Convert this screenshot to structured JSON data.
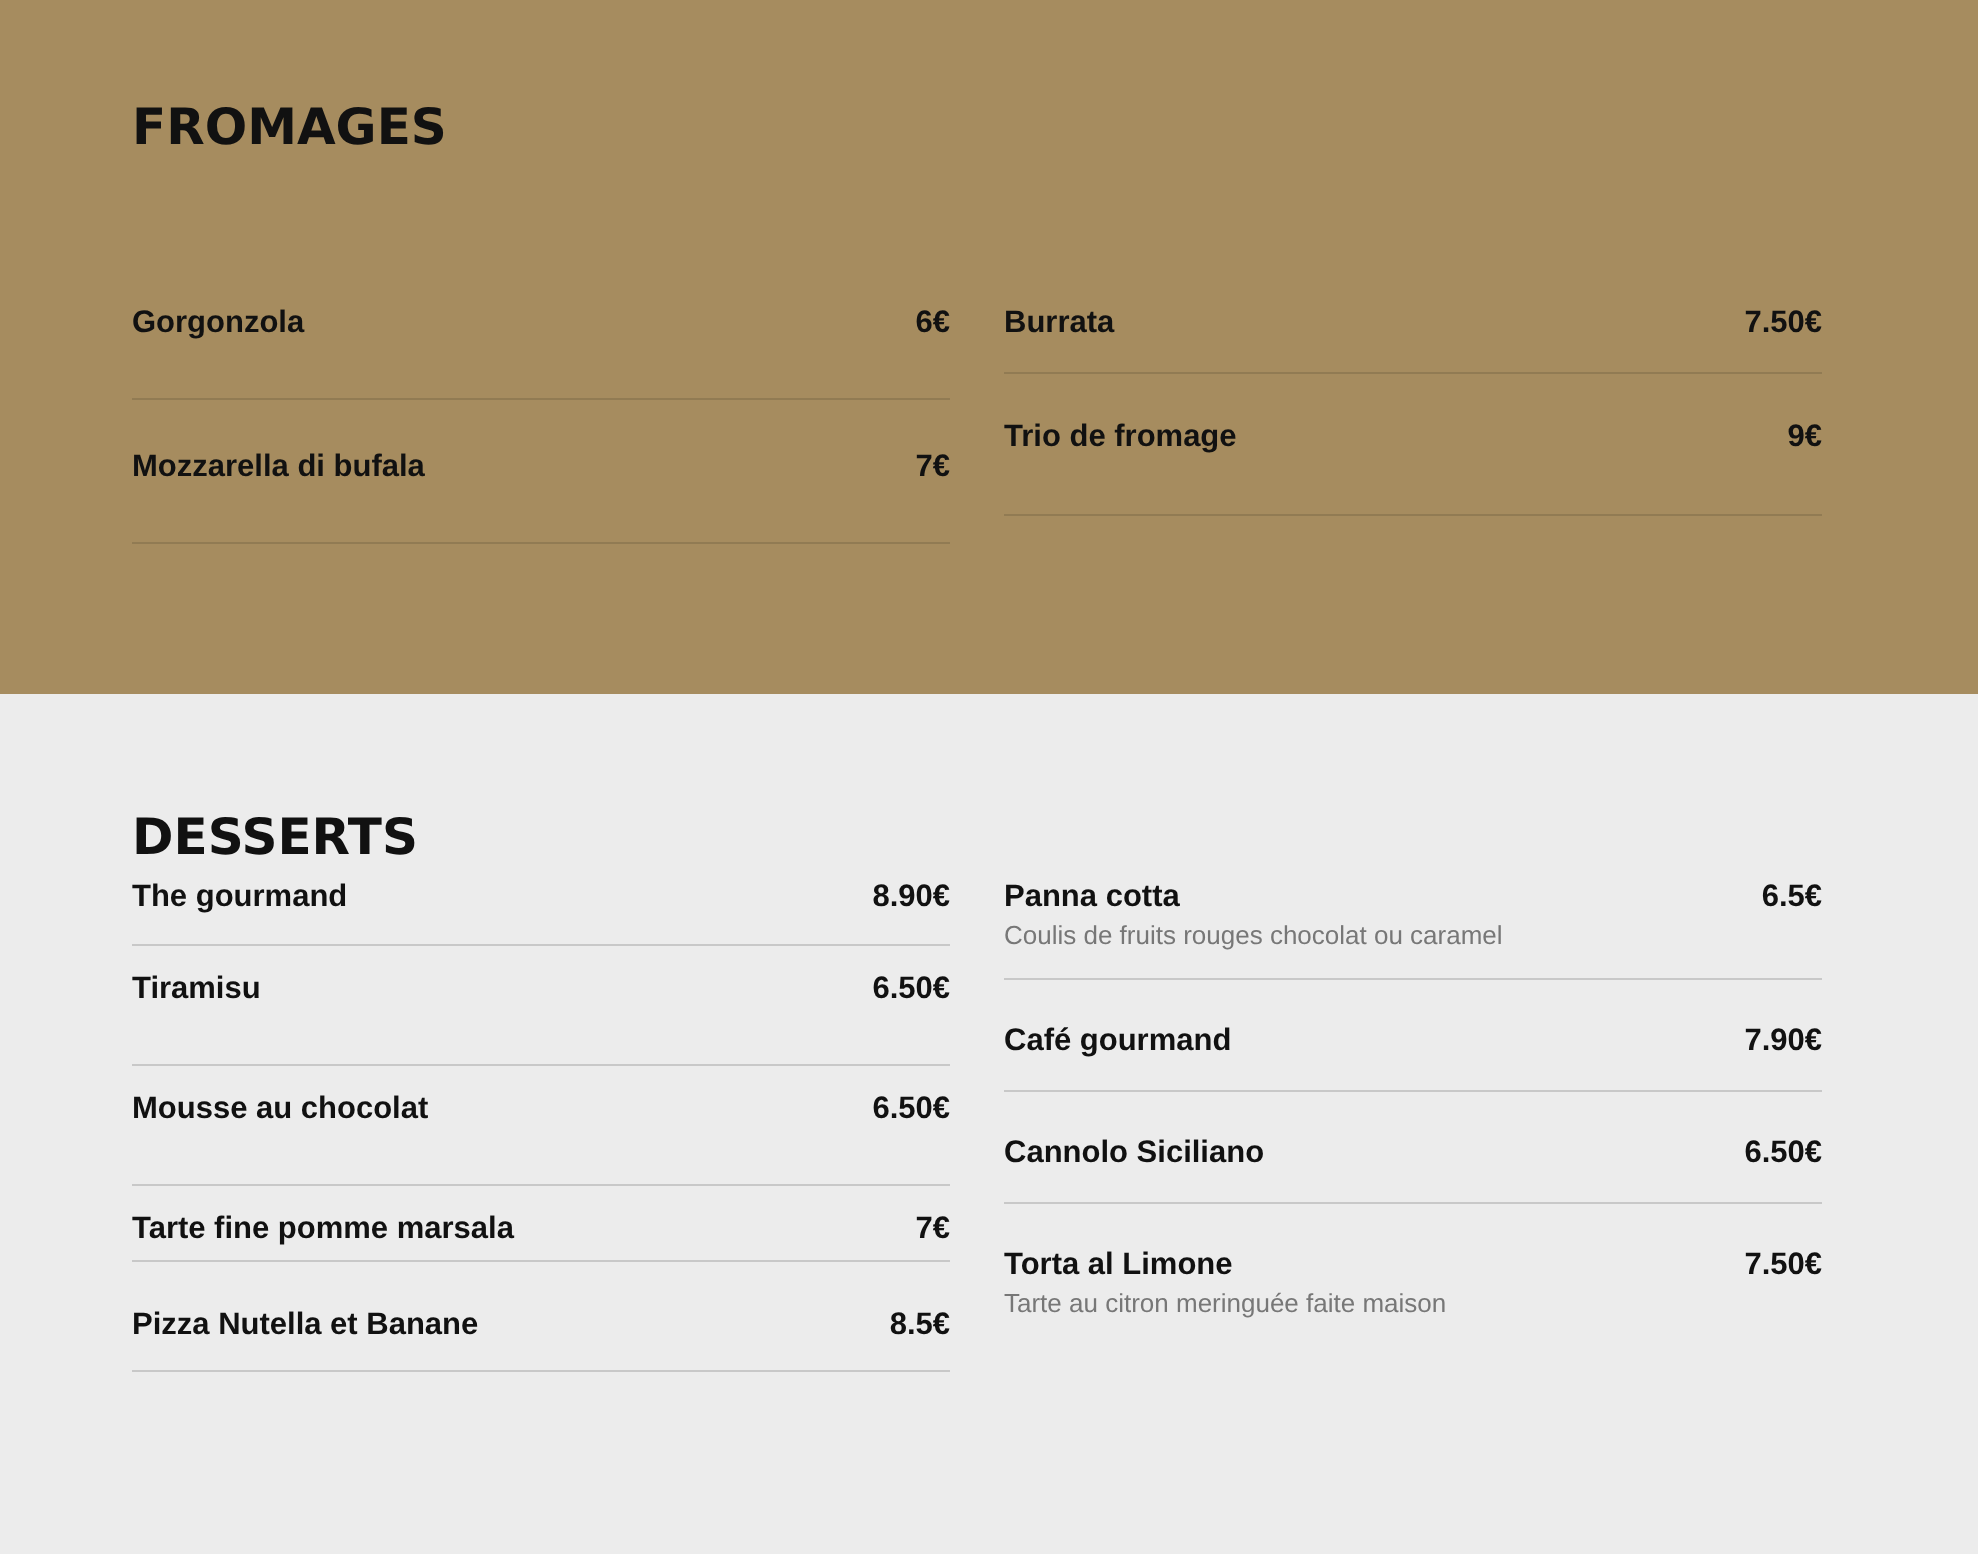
{
  "sections": [
    {
      "title": "FROMAGES",
      "kind": "dark",
      "columns": [
        [
          {
            "name": "Gorgonzola",
            "price": "6€"
          },
          {
            "name": "Mozzarella di bufala",
            "price": "7€"
          }
        ],
        [
          {
            "name": "Burrata",
            "price": "7.50€"
          },
          {
            "name": "Trio de fromage",
            "price": "9€"
          }
        ]
      ]
    },
    {
      "title": "DESSERTS",
      "kind": "light",
      "columns": [
        [
          {
            "name": "The gourmand",
            "price": "8.90€"
          },
          {
            "name": "Tiramisu",
            "price": "6.50€"
          },
          {
            "name": "Mousse au chocolat",
            "price": "6.50€"
          },
          {
            "name": "Tarte fine pomme marsala",
            "price": "7€"
          },
          {
            "name": "Pizza Nutella et Banane",
            "price": "8.5€"
          }
        ],
        [
          {
            "name": "Panna cotta",
            "price": "6.5€",
            "description": "Coulis de fruits rouges chocolat ou caramel"
          },
          {
            "name": "Café gourmand",
            "price": "7.90€"
          },
          {
            "name": "Cannolo Siciliano",
            "price": "6.50€"
          },
          {
            "name": "Torta al Limone",
            "price": "7.50€",
            "description": "Tarte au citron meringuée faite maison"
          }
        ]
      ]
    }
  ]
}
